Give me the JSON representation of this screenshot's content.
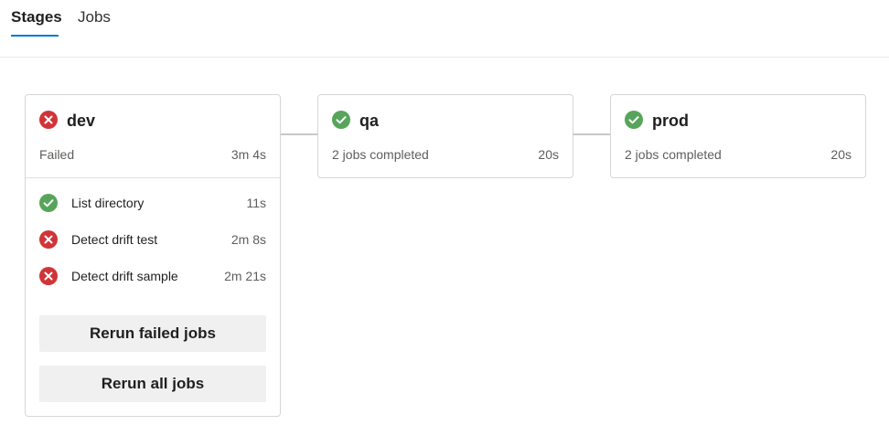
{
  "tabs": [
    {
      "label": "Stages",
      "active": true
    },
    {
      "label": "Jobs",
      "active": false
    }
  ],
  "colors": {
    "failed": "#d13438",
    "succeeded": "#57a55a",
    "accent": "#0078d4"
  },
  "stages": [
    {
      "name": "dev",
      "status_icon": "failed-icon",
      "status": "Failed",
      "duration": "3m 4s",
      "jobs": [
        {
          "name": "List directory",
          "duration": "11s",
          "status_icon": "succeeded-icon"
        },
        {
          "name": "Detect drift test",
          "duration": "2m 8s",
          "status_icon": "failed-icon"
        },
        {
          "name": "Detect drift sample",
          "duration": "2m 21s",
          "status_icon": "failed-icon"
        }
      ],
      "actions": {
        "rerun_failed": "Rerun failed jobs",
        "rerun_all": "Rerun all jobs"
      }
    },
    {
      "name": "qa",
      "status_icon": "succeeded-icon",
      "status": "2 jobs completed",
      "duration": "20s"
    },
    {
      "name": "prod",
      "status_icon": "succeeded-icon",
      "status": "2 jobs completed",
      "duration": "20s"
    }
  ]
}
